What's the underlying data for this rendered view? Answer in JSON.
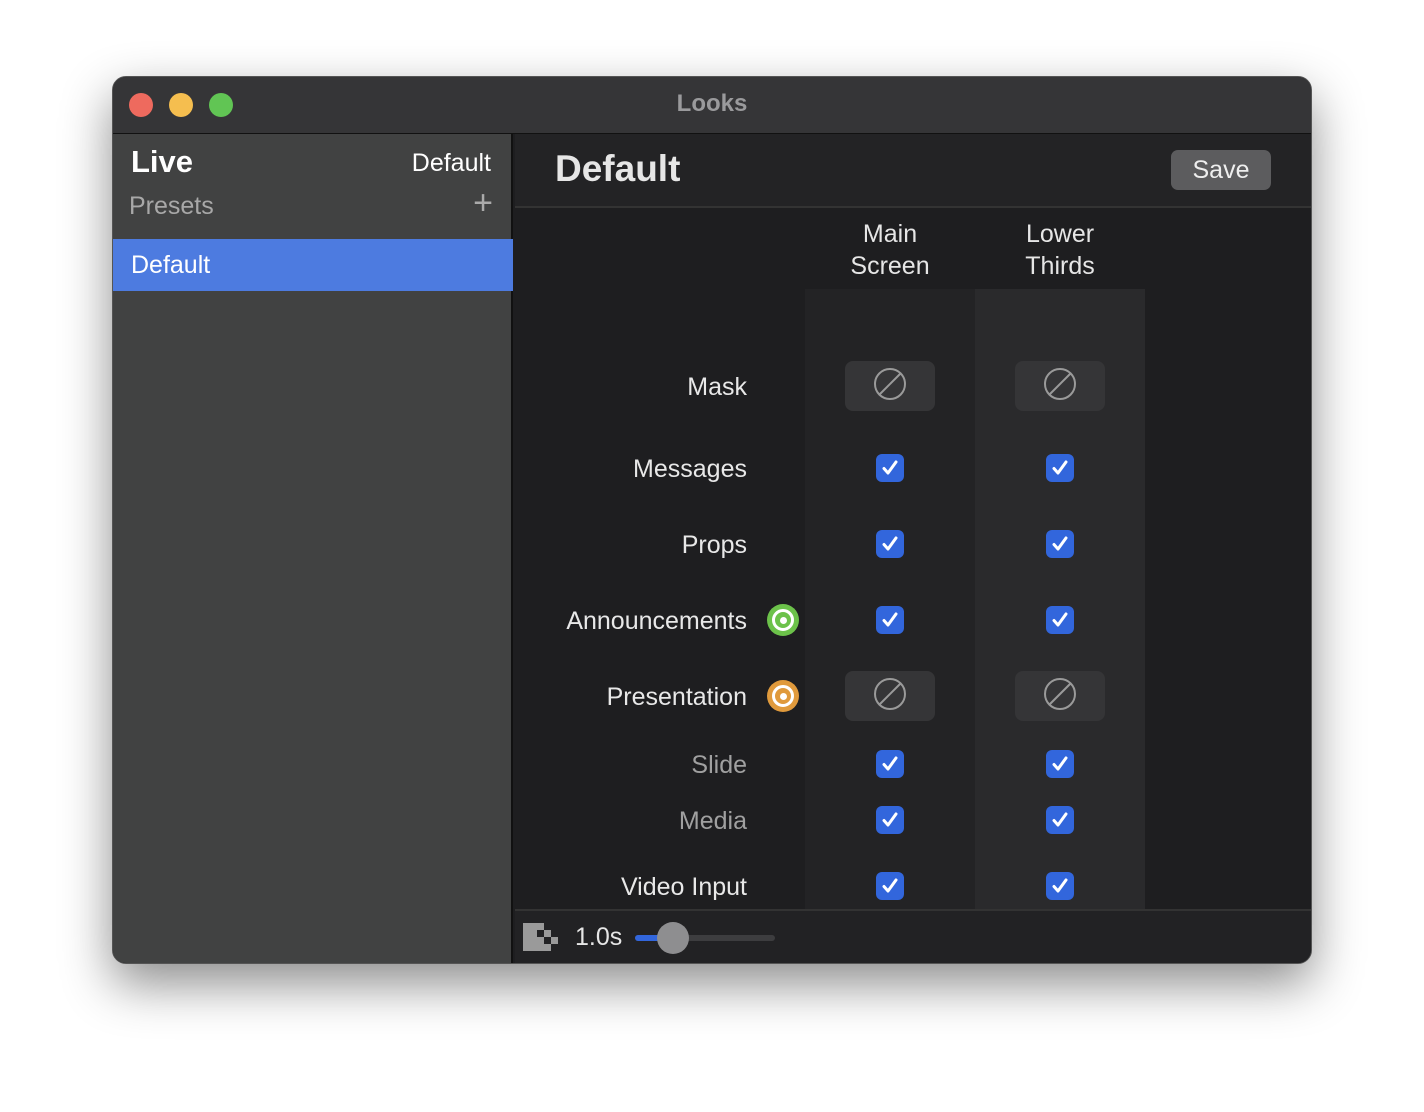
{
  "window": {
    "title": "Looks"
  },
  "sidebar": {
    "live_label": "Live",
    "live_value": "Default",
    "presets_label": "Presets",
    "presets": [
      {
        "label": "Default",
        "selected": true
      }
    ]
  },
  "main": {
    "title": "Default",
    "save_label": "Save",
    "columns": [
      {
        "label_line1": "Main",
        "label_line2": "Screen"
      },
      {
        "label_line1": "Lower",
        "label_line2": "Thirds"
      }
    ],
    "rows": [
      {
        "label": "Mask",
        "sub": false,
        "values": [
          "none",
          "none"
        ]
      },
      {
        "label": "Messages",
        "sub": false,
        "values": [
          "checked",
          "checked"
        ]
      },
      {
        "label": "Props",
        "sub": false,
        "values": [
          "checked",
          "checked"
        ]
      },
      {
        "label": "Announcements",
        "sub": false,
        "status": "green",
        "values": [
          "checked",
          "checked"
        ]
      },
      {
        "label": "Presentation",
        "sub": false,
        "status": "orange",
        "values": [
          "none",
          "none"
        ]
      },
      {
        "label": "Slide",
        "sub": true,
        "values": [
          "checked",
          "checked"
        ]
      },
      {
        "label": "Media",
        "sub": true,
        "values": [
          "checked",
          "checked"
        ]
      },
      {
        "label": "Video Input",
        "sub": false,
        "values": [
          "checked",
          "checked"
        ]
      }
    ],
    "footer": {
      "transition_icon": "checkerboard-transition-icon",
      "duration": "1.0s",
      "slider_fraction": 0.27
    }
  },
  "colors": {
    "accent": "#3266dc",
    "selection": "#4d7be0",
    "status_green": "#6cc24a",
    "status_orange": "#e09a3c"
  }
}
